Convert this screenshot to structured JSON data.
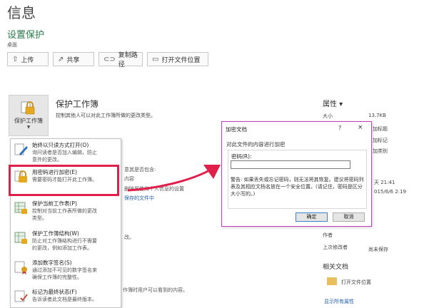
{
  "header": {
    "title": "信息",
    "section": "设置保护",
    "location": "桌面"
  },
  "toolbar": [
    {
      "label": "上传",
      "icon": "upload-icon",
      "glyph": "⇧"
    },
    {
      "label": "共享",
      "icon": "share-icon",
      "glyph": "⇗"
    },
    {
      "label": "复制路径",
      "icon": "link-icon",
      "glyph": "⊂⊃"
    },
    {
      "label": "打开文件位置",
      "icon": "folder-icon",
      "glyph": "▭"
    }
  ],
  "protect": {
    "tile_label": "保护工作簿",
    "title": "保护工作簿",
    "desc": "控制其他人可以对此工作簿所做的更改类型。"
  },
  "menu": [
    {
      "title": "始终以只读方式打开(O)",
      "desc": [
        "询问读者是否加入编辑，防止",
        "意外的更改。"
      ]
    },
    {
      "title": "用密码进行加密(E)",
      "desc": [
        "需要密码才能打开此工作簿。"
      ]
    },
    {
      "title": "保护当前工作表(P)",
      "desc": [
        "控制对当前工作表所做的更改",
        "类型。"
      ]
    },
    {
      "title": "保护工作簿结构(W)",
      "desc": [
        "防止对工作簿结构进行不需要",
        "的更改，例如添加工作表。"
      ]
    },
    {
      "title": "添加数字签名(S)",
      "desc": [
        "通过添加不可见的数字签名来",
        "确保工作簿的完整性。"
      ]
    },
    {
      "title": "标记为最终状态(F)",
      "desc": [
        "告诉读者此文档是最终版本。"
      ]
    }
  ],
  "background_fragments": {
    "inspect": "意其是否包含:",
    "content": "内容",
    "remove": "删除属性和个人信息的设置",
    "link": "保存的文件中",
    "change": "改。",
    "view": "作簿时用户可以看到的内容。"
  },
  "properties": {
    "title": "属性",
    "rows": [
      {
        "label": "大小",
        "value": "13.7KB"
      },
      {
        "label": "",
        "value": "加标题"
      },
      {
        "label": "",
        "value": "加标记"
      },
      {
        "label": "",
        "value": "加类别"
      }
    ],
    "dates": [
      "天 21:41",
      "015/6/6 2:19"
    ],
    "related_people": [
      {
        "label": "作者",
        "value": ""
      },
      {
        "label": "上次修改者",
        "value": "尚未保存"
      }
    ],
    "related_docs_title": "相关文档",
    "open_location": "打开文件位置",
    "show_all": "显示所有属性"
  },
  "dialog": {
    "title": "加密文档",
    "help": "?",
    "close": "×",
    "heading": "对此文件的内容进行加密",
    "password_label": "密码(R):",
    "password_value": "",
    "warning": "警告: 如果丢失或忘记密码，则无法将其恢复。建议将密码列表及其相应文档名放在一个安全位置。(请记住，密码是区分大小写的。)",
    "ok": "确定",
    "cancel": "取消"
  },
  "colors": {
    "accent_green": "#2a7a4a",
    "highlight_red": "#e0204a",
    "arrow": "#e0204a",
    "dialog_border": "#c040c0"
  }
}
